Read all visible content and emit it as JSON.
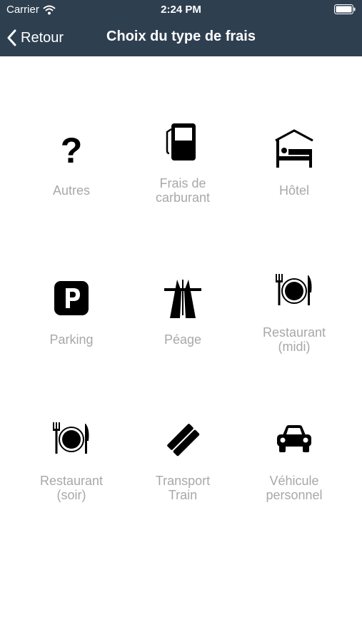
{
  "status_bar": {
    "carrier": "Carrier",
    "time": "2:24 PM"
  },
  "navbar": {
    "back_label": "Retour",
    "title": "Choix du type de frais"
  },
  "colors": {
    "navbar_bg": "#2e3f50",
    "label_gray": "#a8a8a8",
    "icon": "#000000"
  },
  "expense_types": [
    {
      "label": "Autres",
      "icon": "question-mark-icon"
    },
    {
      "label": "Frais de\ncarburant",
      "icon": "fuel-pump-icon"
    },
    {
      "label": "Hôtel",
      "icon": "hotel-bed-icon"
    },
    {
      "label": "Parking",
      "icon": "parking-icon"
    },
    {
      "label": "Péage",
      "icon": "highway-toll-icon"
    },
    {
      "label": "Restaurant\n(midi)",
      "icon": "plate-cutlery-icon"
    },
    {
      "label": "Restaurant\n(soir)",
      "icon": "plate-cutlery-icon"
    },
    {
      "label": "Transport\nTrain",
      "icon": "train-ticket-icon"
    },
    {
      "label": "Véhicule\npersonnel",
      "icon": "car-icon"
    }
  ]
}
